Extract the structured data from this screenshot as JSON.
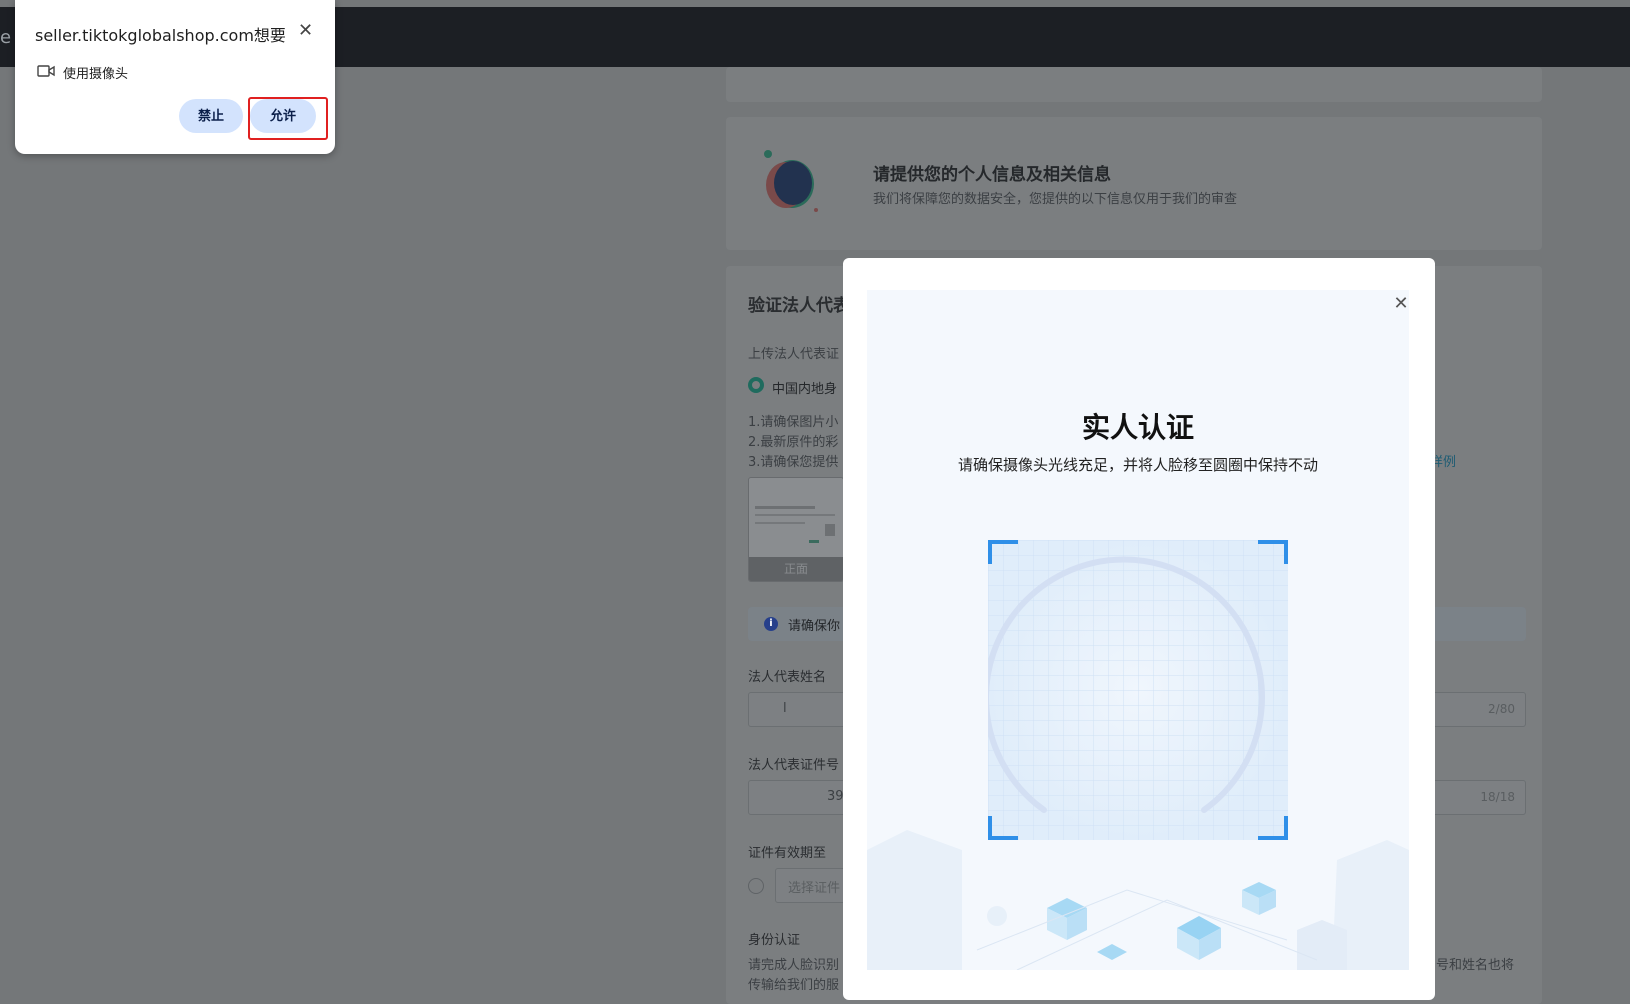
{
  "top_bar": {
    "edge_text": "e"
  },
  "background_page": {
    "profile_card": {
      "title": "请提供您的个人信息及相关信息",
      "subtitle": "我们将保障您的数据安全，您提供的以下信息仅用于我们的审查"
    },
    "verify_section": {
      "title": "验证法人代表",
      "upload_label": "上传法人代表证",
      "id_option": "中国内地身",
      "rule_1": "1.请确保图片小",
      "rule_2": "2.最新原件的彩",
      "rule_3": "3.请确保您提供",
      "example_link": "详例",
      "thumb_label": "正面",
      "info_text": "请确保你",
      "name_label": "法人代表姓名",
      "name_value": "l",
      "name_counter": "2/80",
      "id_label": "法人代表证件号",
      "id_value": "39",
      "id_counter": "18/18",
      "expiry_label": "证件有效期至",
      "expiry_placeholder": "选择证件",
      "identity_label": "身份认证",
      "identity_text_1": "请完成人脸识别",
      "identity_text_2": "传输给我们的服",
      "identity_text_right": "号和姓名也将"
    }
  },
  "face_modal": {
    "title": "实人认证",
    "subtitle": "请确保摄像头光线充足，并将人脸移至圆圈中保持不动",
    "close_icon": "close-icon"
  },
  "permission_prompt": {
    "title": "seller.tiktokglobalshop.com想要",
    "permission_item": "使用摄像头",
    "deny_label": "禁止",
    "allow_label": "允许",
    "camera_icon": "camera-icon"
  },
  "colors": {
    "accent_blue": "#2f8fe8",
    "highlight_red": "#e02020",
    "button_blue": "#d3e3fd"
  }
}
